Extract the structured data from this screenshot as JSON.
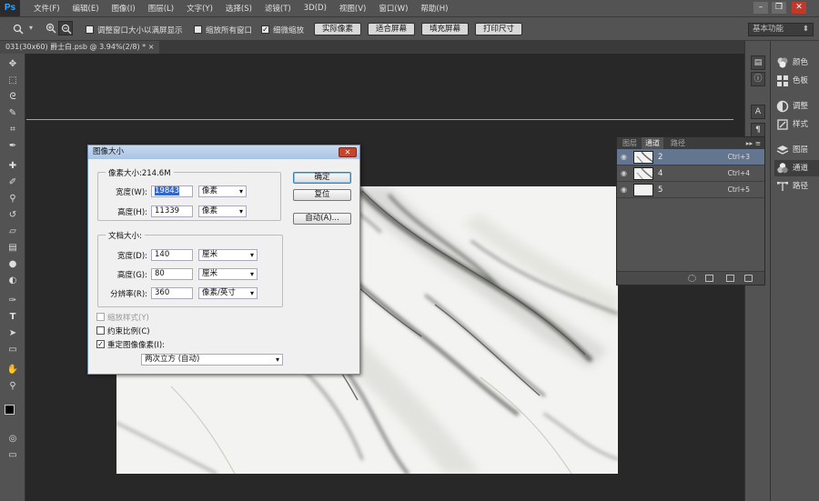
{
  "app": {
    "logo": "Ps"
  },
  "menu": [
    "文件(F)",
    "编辑(E)",
    "图像(I)",
    "图层(L)",
    "文字(Y)",
    "选择(S)",
    "滤镜(T)",
    "3D(D)",
    "视图(V)",
    "窗口(W)",
    "帮助(H)"
  ],
  "window_controls": {
    "minimize": "–",
    "restore": "❐",
    "close": "✕"
  },
  "options": {
    "resize_windows_label": "调整窗口大小以满屏显示",
    "zoom_all_label": "缩放所有窗口",
    "scrubby_zoom_label": "细微缩放",
    "actual_pixels": "实际像素",
    "fit_screen": "适合屏幕",
    "fill_screen": "填充屏幕",
    "print_size": "打印尺寸",
    "workspace": "基本功能"
  },
  "doc_tab": {
    "label": "031(30x60) 爵士白.psb @ 3.94%(2/8) *  ×"
  },
  "right_panel": {
    "items": [
      {
        "label": "颜色",
        "icon": "color-icon"
      },
      {
        "label": "色板",
        "icon": "swatches-icon"
      },
      {
        "label": "调整",
        "icon": "adjustments-icon"
      },
      {
        "label": "样式",
        "icon": "styles-icon"
      },
      {
        "label": "图层",
        "icon": "layers-icon"
      },
      {
        "label": "通道",
        "icon": "channels-icon"
      },
      {
        "label": "路径",
        "icon": "paths-icon"
      }
    ]
  },
  "channels_panel": {
    "tabs": [
      "图层",
      "通道",
      "路径"
    ],
    "active_tab": "通道",
    "menu_glyph": "▸▸  ≡",
    "rows": [
      {
        "name": "2",
        "shortcut": "Ctrl+3",
        "selected": true
      },
      {
        "name": "4",
        "shortcut": "Ctrl+4",
        "selected": false
      },
      {
        "name": "5",
        "shortcut": "Ctrl+5",
        "selected": false
      }
    ]
  },
  "dialog": {
    "title": "图像大小",
    "close": "✕",
    "pixel_group": "像素大小:214.6M",
    "width_label": "宽度(W):",
    "width_value": "19843",
    "width_unit": "像素",
    "height_label": "高度(H):",
    "height_value": "11339",
    "height_unit": "像素",
    "doc_group": "文档大小:",
    "doc_width_label": "宽度(D):",
    "doc_width_value": "140",
    "doc_width_unit": "厘米",
    "doc_height_label": "高度(G):",
    "doc_height_value": "80",
    "doc_height_unit": "厘米",
    "resolution_label": "分辨率(R):",
    "resolution_value": "360",
    "resolution_unit": "像素/英寸",
    "scale_styles": "缩放样式(Y)",
    "constrain": "约束比例(C)",
    "resample": "重定图像像素(I):",
    "resample_method": "两次立方 (自动)",
    "ok": "确定",
    "reset": "复位",
    "auto": "自动(A)..."
  }
}
